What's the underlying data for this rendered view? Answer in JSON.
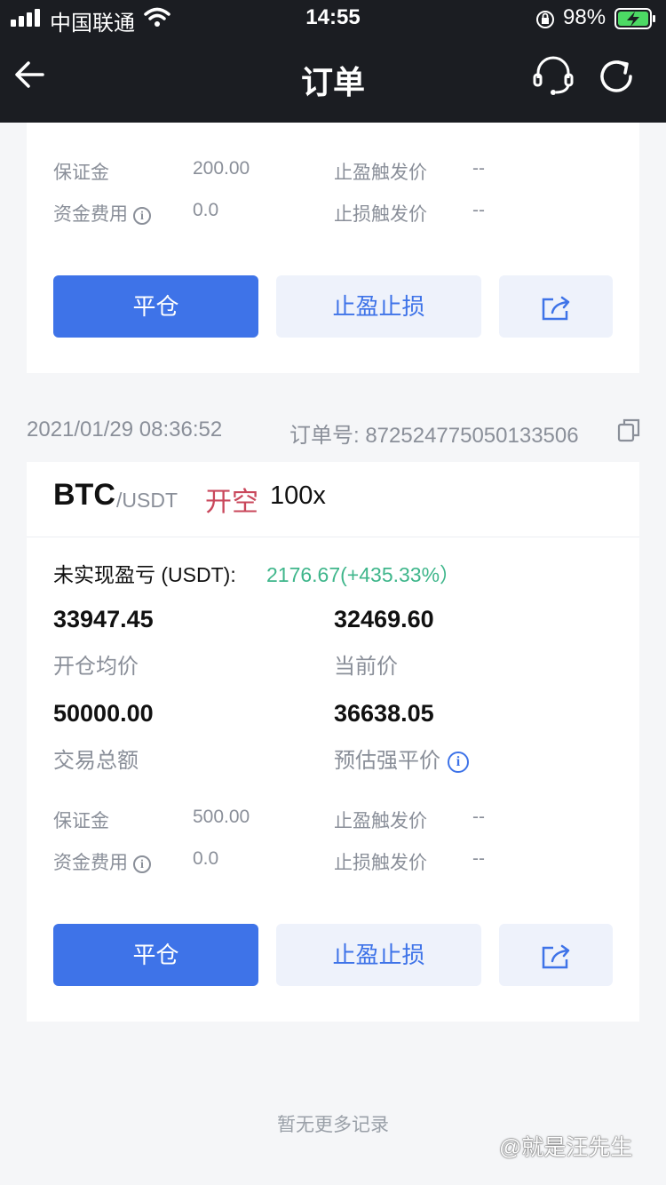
{
  "status_bar": {
    "carrier": "中国联通",
    "time": "14:55",
    "battery": "98%"
  },
  "nav": {
    "title": "订单"
  },
  "order1": {
    "margin_label": "保证金",
    "margin_value": "200.00",
    "funding_label": "资金费用",
    "funding_value": "0.0",
    "tp_label": "止盈触发价",
    "tp_value": "--",
    "sl_label": "止损触发价",
    "sl_value": "--",
    "close_button": "平仓",
    "tpsl_button": "止盈止损"
  },
  "order2": {
    "datetime": "2021/01/29 08:36:52",
    "order_no": "订单号: 872524775050133506",
    "symbol": "BTC",
    "quote": "/USDT",
    "side": "开空",
    "leverage": "100x",
    "pnl_label": "未实现盈亏 (USDT):",
    "pnl_value": "2176.67(+435.33%）",
    "open_price": "33947.45",
    "open_price_label": "开仓均价",
    "current_price": "32469.60",
    "current_price_label": "当前价",
    "total": "50000.00",
    "total_label": "交易总额",
    "liq_price": "36638.05",
    "liq_price_label": "预估强平价",
    "margin_label": "保证金",
    "margin_value": "500.00",
    "funding_label": "资金费用",
    "funding_value": "0.0",
    "tp_label": "止盈触发价",
    "tp_value": "--",
    "sl_label": "止损触发价",
    "sl_value": "--",
    "close_button": "平仓",
    "tpsl_button": "止盈止损"
  },
  "footer": {
    "no_more": "暂无更多记录",
    "watermark": "@就是汪先生"
  },
  "colors": {
    "header_bg": "#1b1d22",
    "primary": "#3e73e8",
    "short_red": "#c9475b",
    "profit_green": "#3fb68b"
  }
}
